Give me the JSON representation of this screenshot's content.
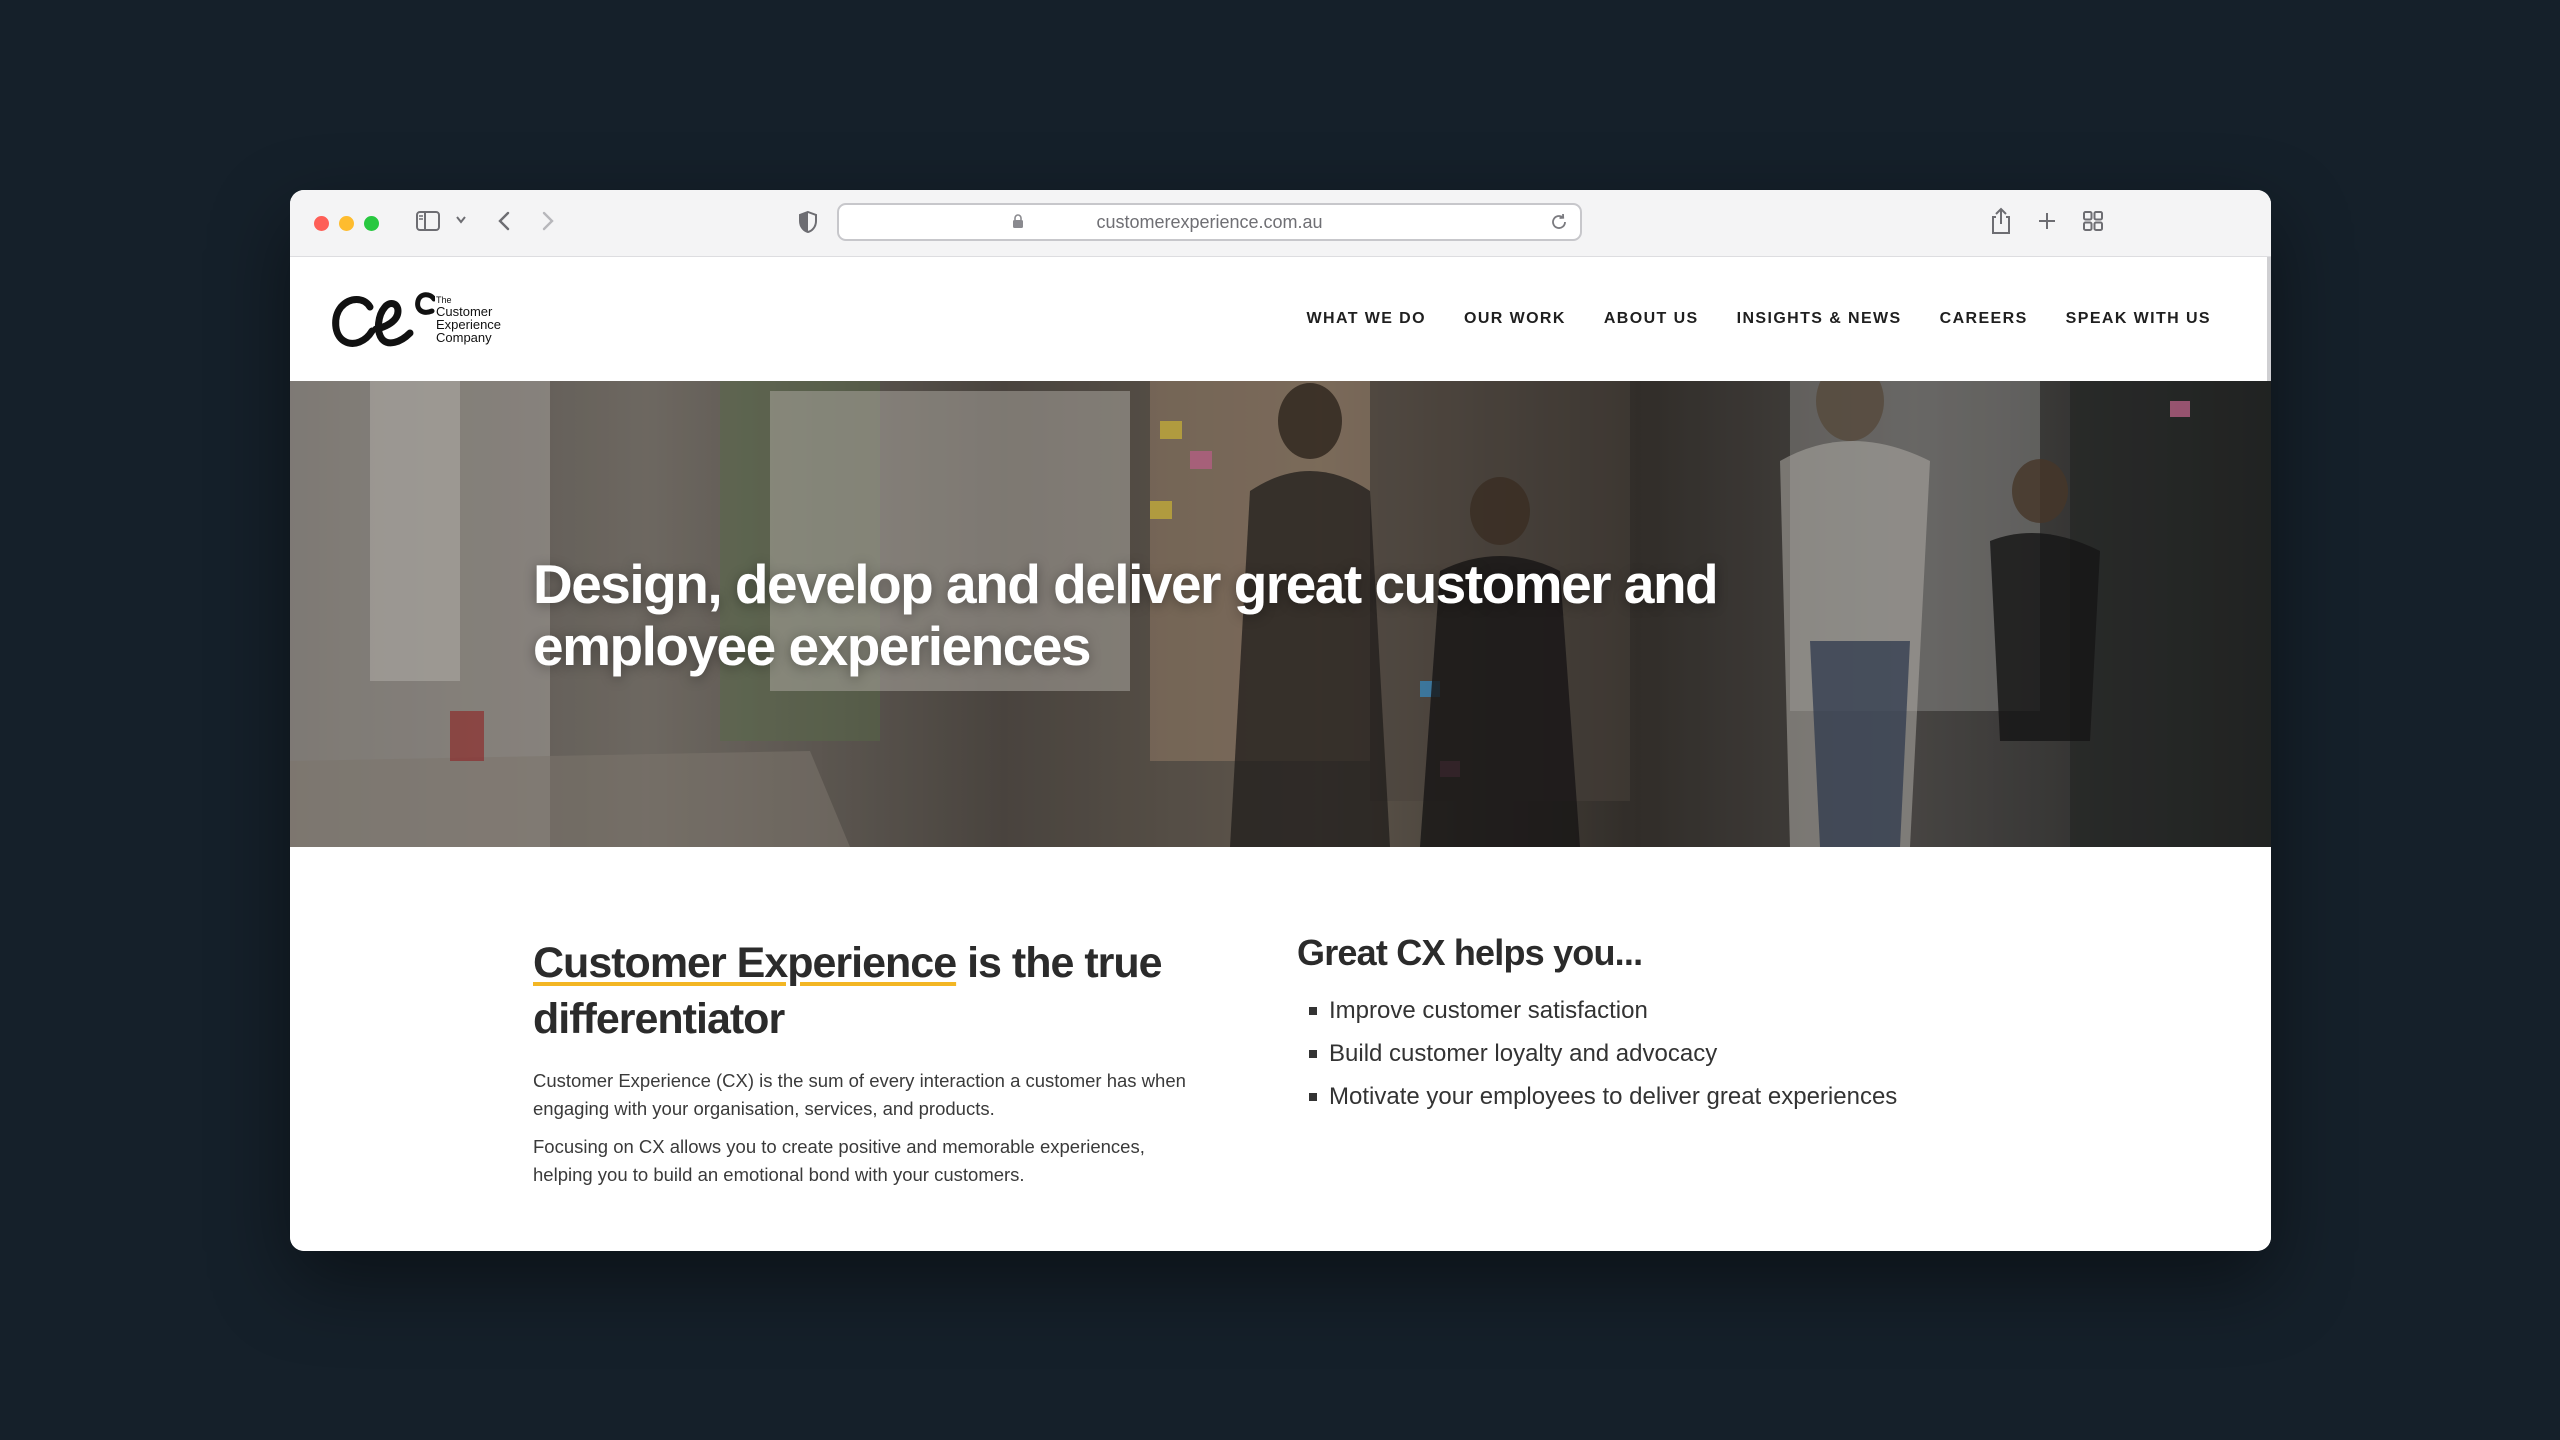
{
  "browser": {
    "url": "customerexperience.com.au"
  },
  "logo": {
    "line1": "The",
    "line2": "Customer",
    "line3": "Experience",
    "line4": "Company"
  },
  "nav": {
    "items": [
      "WHAT WE DO",
      "OUR WORK",
      "ABOUT US",
      "INSIGHTS & NEWS",
      "CAREERS",
      "SPEAK WITH US"
    ]
  },
  "hero": {
    "title": "Design, develop and deliver great customer and employee experiences"
  },
  "intro": {
    "heading_highlight": "Customer Experience",
    "heading_rest": " is the true differentiator",
    "para1": "Customer Experience (CX) is the sum of every interaction a customer has when engaging with your organisation, services, and products.",
    "para2": "Focusing on CX allows you to create positive and memorable experiences, helping you to build an emotional bond with your customers."
  },
  "benefits": {
    "heading": "Great CX helps you...",
    "items": [
      "Improve customer satisfaction",
      "Build customer loyalty and advocacy",
      "Motivate your employees to deliver great experiences"
    ]
  },
  "colors": {
    "accent_underline": "#f3b624",
    "page_background": "#15202a"
  }
}
